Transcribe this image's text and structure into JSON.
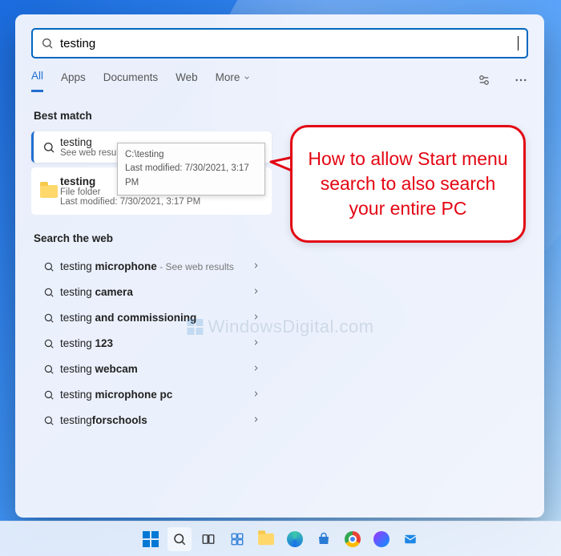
{
  "search": {
    "query": "testing"
  },
  "tabs": {
    "items": [
      {
        "label": "All",
        "active": true
      },
      {
        "label": "Apps"
      },
      {
        "label": "Documents"
      },
      {
        "label": "Web"
      },
      {
        "label": "More"
      }
    ]
  },
  "best_match": {
    "header": "Best match",
    "item1": {
      "title": "testing",
      "sub": "See web results"
    },
    "item2": {
      "title": "testing",
      "sub": "File folder",
      "sub2": "Last modified: 7/30/2021, 3:17 PM"
    }
  },
  "tooltip": {
    "line1": "C:\\testing",
    "line2": "Last modified: 7/30/2021, 3:17 PM"
  },
  "web": {
    "header": "Search the web",
    "items": [
      {
        "prefix": "testing ",
        "bold": "microphone",
        "suffix": " - See web results"
      },
      {
        "prefix": "testing ",
        "bold": "camera",
        "suffix": ""
      },
      {
        "prefix": "testing ",
        "bold": "and commissioning",
        "suffix": ""
      },
      {
        "prefix": "testing ",
        "bold": "123",
        "suffix": ""
      },
      {
        "prefix": "testing ",
        "bold": "webcam",
        "suffix": ""
      },
      {
        "prefix": "testing ",
        "bold": "microphone pc",
        "suffix": ""
      },
      {
        "prefix": "testing",
        "bold": "forschools",
        "suffix": ""
      }
    ]
  },
  "callout": "How to allow Start menu search to also search your entire PC",
  "watermark": "WindowsDigital.com"
}
